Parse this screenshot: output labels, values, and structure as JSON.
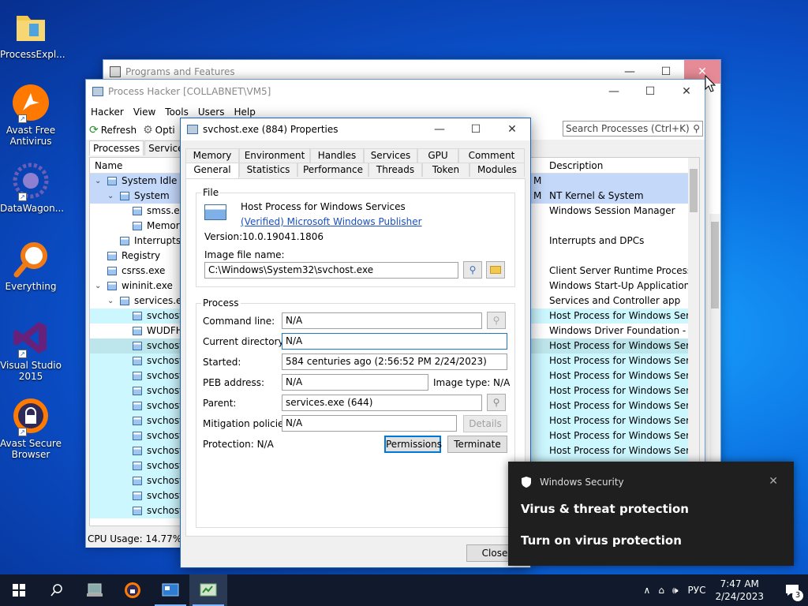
{
  "desktop": {
    "icons": [
      {
        "label": "ProcessExpl..."
      },
      {
        "label": "Avast Free Antivirus"
      },
      {
        "label": "DataWagon..."
      },
      {
        "label": "Everything"
      },
      {
        "label": "Visual Studio 2015"
      },
      {
        "label": "Avast Secure Browser"
      }
    ]
  },
  "programs_window": {
    "title": "Programs and Features"
  },
  "process_hacker": {
    "title": "Process Hacker [COLLABNET\\VM5]",
    "menu": [
      "Hacker",
      "View",
      "Tools",
      "Users",
      "Help"
    ],
    "toolbar": {
      "refresh": "Refresh",
      "options": "Opti"
    },
    "search_placeholder": "Search Processes (Ctrl+K)",
    "tabs": [
      "Processes",
      "Services"
    ],
    "columns": {
      "name": "Name",
      "description": "Description"
    },
    "rows": [
      {
        "name": "System Idle P",
        "desc": "",
        "m": "M"
      },
      {
        "name": "System",
        "desc": "NT Kernel & System",
        "m": "M"
      },
      {
        "name": "smss.ex",
        "desc": "Windows Session Manager",
        "m": ""
      },
      {
        "name": "Memor",
        "desc": "",
        "m": ""
      },
      {
        "name": "Interrupts",
        "desc": "Interrupts and DPCs",
        "m": ""
      },
      {
        "name": "Registry",
        "desc": "",
        "m": ""
      },
      {
        "name": "csrss.exe",
        "desc": "Client Server Runtime Process",
        "m": ""
      },
      {
        "name": "wininit.exe",
        "desc": "Windows Start-Up Application",
        "m": ""
      },
      {
        "name": "services.ex",
        "desc": "Services and Controller app",
        "m": ""
      },
      {
        "name": "svchost",
        "desc": "Host Process for Windows Ser...",
        "m": ""
      },
      {
        "name": "WUDFH",
        "desc": "Windows Driver Foundation - ...",
        "m": ""
      },
      {
        "name": "svchost",
        "desc": "Host Process for Windows Ser...",
        "m": ""
      },
      {
        "name": "svchost",
        "desc": "Host Process for Windows Ser...",
        "m": ""
      },
      {
        "name": "svchost",
        "desc": "Host Process for Windows Ser...",
        "m": ""
      },
      {
        "name": "svchost",
        "desc": "Host Process for Windows Ser...",
        "m": ""
      },
      {
        "name": "svchost",
        "desc": "Host Process for Windows Ser...",
        "m": ""
      },
      {
        "name": "svchost",
        "desc": "Host Process for Windows Ser...",
        "m": ""
      },
      {
        "name": "svchost",
        "desc": "Host Process for Windows Ser...",
        "m": ""
      },
      {
        "name": "svchost",
        "desc": "Host Process for Windows Ser...",
        "m": ""
      },
      {
        "name": "svchost",
        "desc": "",
        "m": ""
      },
      {
        "name": "svchost",
        "desc": "",
        "m": ""
      },
      {
        "name": "svchost",
        "desc": "",
        "m": ""
      },
      {
        "name": "svchost",
        "desc": "",
        "m": ""
      }
    ],
    "status": {
      "cpu": "CPU Usage: 14.77%",
      "p": "P"
    }
  },
  "dialog": {
    "title": "svchost.exe (884) Properties",
    "tabs_row1": [
      "Memory",
      "Environment",
      "Handles",
      "Services",
      "GPU",
      "Comment"
    ],
    "tabs_row2": [
      "General",
      "Statistics",
      "Performance",
      "Threads",
      "Token",
      "Modules"
    ],
    "file": {
      "group": "File",
      "description": "Host Process for Windows Services",
      "publisher": "(Verified) Microsoft Windows Publisher",
      "version_label": "Version:",
      "version": "10.0.19041.1806",
      "image_label": "Image file name:",
      "image_path": "C:\\Windows\\System32\\svchost.exe"
    },
    "process": {
      "group": "Process",
      "command_label": "Command line:",
      "command": "N/A",
      "curdir_label": "Current directory:",
      "curdir": "N/A",
      "started_label": "Started:",
      "started": "584 centuries ago (2:56:52 PM 2/24/2023)",
      "peb_label": "PEB address:",
      "peb": "N/A",
      "image_type": "Image type:  N/A",
      "parent_label": "Parent:",
      "parent": "services.exe (644)",
      "mitigation_label": "Mitigation policies:",
      "mitigation": "N/A",
      "details": "Details",
      "protection": "Protection:   N/A",
      "permissions": "Permissions",
      "terminate": "Terminate"
    },
    "close": "Close"
  },
  "toast": {
    "app": "Windows Security",
    "heading": "Virus & threat protection",
    "body": "Turn on virus protection"
  },
  "taskbar": {
    "lang": "РУС",
    "time": "7:47 AM",
    "date": "2/24/2023",
    "notifications": "3"
  }
}
